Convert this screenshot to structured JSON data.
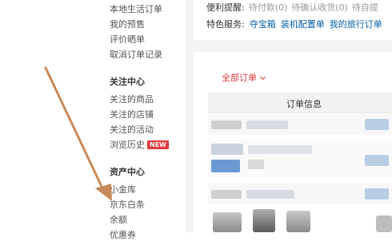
{
  "sidebar": {
    "items_top": [
      {
        "label": "本地生活订单"
      },
      {
        "label": "我的预售"
      },
      {
        "label": "评价晒单"
      },
      {
        "label": "取消订单记录"
      }
    ],
    "section_follow": {
      "title": "关注中心",
      "items": [
        {
          "label": "关注的商品"
        },
        {
          "label": "关注的店铺"
        },
        {
          "label": "关注的活动"
        },
        {
          "label": "浏览历史",
          "badge": "NEW"
        }
      ]
    },
    "section_assets": {
      "title": "资产中心",
      "items": [
        {
          "label": "小金库"
        },
        {
          "label": "京东白条"
        },
        {
          "label": "余额"
        },
        {
          "label": "优惠券"
        }
      ]
    }
  },
  "notice": {
    "label": "便利提醒:",
    "items": [
      "待付款(0)",
      "待确认收货(0)",
      "待自提"
    ]
  },
  "services": {
    "label": "特色服务:",
    "items": [
      "夺宝箱",
      "装机配置单",
      "我的旅行订单"
    ]
  },
  "orders": {
    "filter_label": "全部订单",
    "table_header": "订单信息"
  },
  "colors": {
    "accent_red": "#e4393c",
    "link_blue": "#005ea7",
    "arrow": "#c88a5a"
  },
  "icons": {
    "badge": "new-badge",
    "filter_chevron": "chevron-down-icon",
    "annotation": "annotation-arrow"
  }
}
